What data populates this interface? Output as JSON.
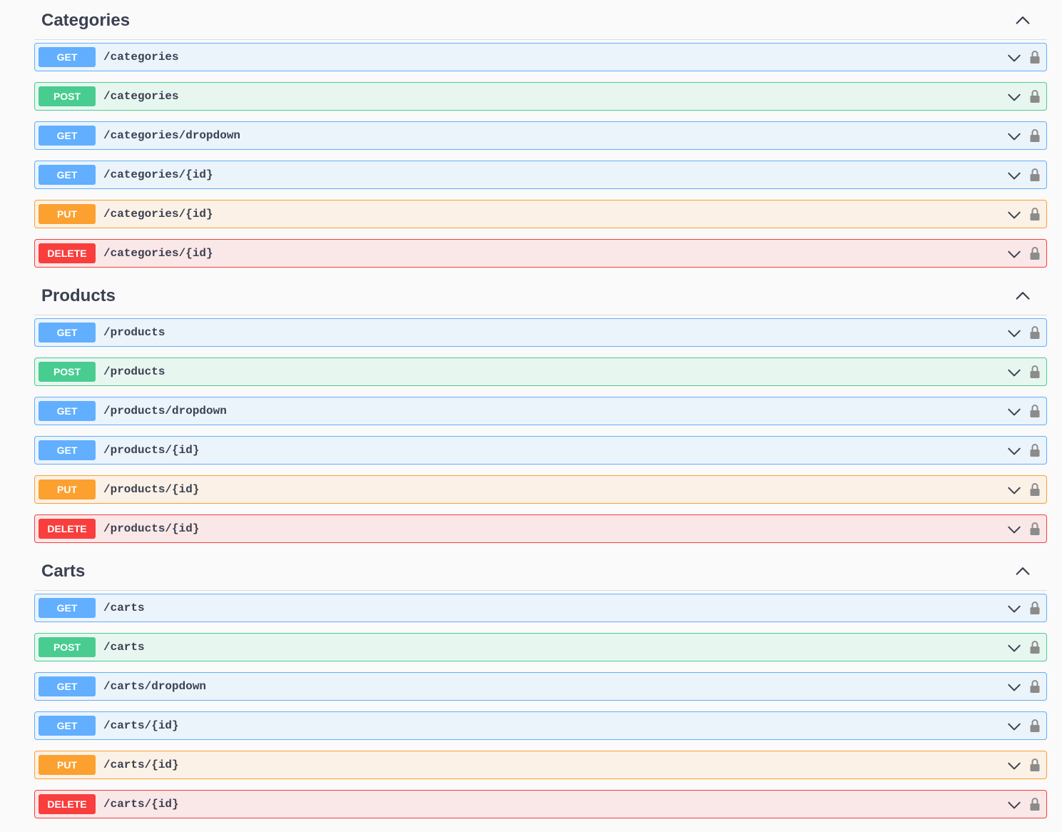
{
  "sections": [
    {
      "title": "Categories",
      "operations": [
        {
          "method": "GET",
          "path": "/categories"
        },
        {
          "method": "POST",
          "path": "/categories"
        },
        {
          "method": "GET",
          "path": "/categories/dropdown"
        },
        {
          "method": "GET",
          "path": "/categories/{id}"
        },
        {
          "method": "PUT",
          "path": "/categories/{id}"
        },
        {
          "method": "DELETE",
          "path": "/categories/{id}"
        }
      ]
    },
    {
      "title": "Products",
      "operations": [
        {
          "method": "GET",
          "path": "/products"
        },
        {
          "method": "POST",
          "path": "/products"
        },
        {
          "method": "GET",
          "path": "/products/dropdown"
        },
        {
          "method": "GET",
          "path": "/products/{id}"
        },
        {
          "method": "PUT",
          "path": "/products/{id}"
        },
        {
          "method": "DELETE",
          "path": "/products/{id}"
        }
      ]
    },
    {
      "title": "Carts",
      "operations": [
        {
          "method": "GET",
          "path": "/carts"
        },
        {
          "method": "POST",
          "path": "/carts"
        },
        {
          "method": "GET",
          "path": "/carts/dropdown"
        },
        {
          "method": "GET",
          "path": "/carts/{id}"
        },
        {
          "method": "PUT",
          "path": "/carts/{id}"
        },
        {
          "method": "DELETE",
          "path": "/carts/{id}"
        }
      ]
    }
  ],
  "method_colors": {
    "GET": "#61affe",
    "POST": "#49cc90",
    "PUT": "#fca130",
    "DELETE": "#f93e3e"
  },
  "icons": {
    "section_toggle": "chevron-up-icon",
    "operation_toggle": "chevron-down-icon",
    "auth": "lock-icon"
  }
}
